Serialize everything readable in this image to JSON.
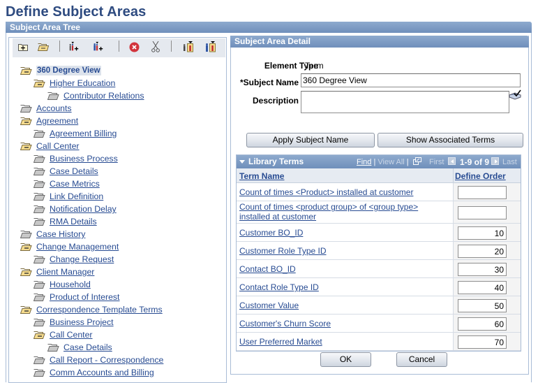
{
  "page": {
    "title": "Define Subject Areas"
  },
  "tree_panel": {
    "header": "Subject Area Tree",
    "toolbar": [
      {
        "name": "insert-sibling-folder-icon",
        "title": "Add Subject"
      },
      {
        "name": "insert-child-folder-icon",
        "title": "Add Child Subject"
      },
      {
        "name": "insert-sibling-term-icon",
        "title": "Add Term"
      },
      {
        "name": "insert-child-term-icon",
        "title": "Add Child Term"
      },
      {
        "name": "delete-icon",
        "title": "Delete"
      },
      {
        "name": "cut-icon",
        "title": "Cut"
      },
      {
        "name": "paste-sibling-icon",
        "title": "Paste as Sibling"
      },
      {
        "name": "paste-child-icon",
        "title": "Paste as Child"
      }
    ],
    "nodes": [
      {
        "label": "360 Degree View",
        "level": 0,
        "open": true,
        "selected": true
      },
      {
        "label": "Higher Education",
        "level": 1,
        "open": true
      },
      {
        "label": "Contributor Relations",
        "level": 2,
        "open": false
      },
      {
        "label": "Accounts",
        "level": 0,
        "open": false
      },
      {
        "label": "Agreement",
        "level": 0,
        "open": true
      },
      {
        "label": "Agreement Billing",
        "level": 1,
        "open": false
      },
      {
        "label": "Call Center",
        "level": 0,
        "open": true
      },
      {
        "label": "Business Process",
        "level": 1,
        "open": false
      },
      {
        "label": "Case Details",
        "level": 1,
        "open": false
      },
      {
        "label": "Case Metrics",
        "level": 1,
        "open": false
      },
      {
        "label": "Link Definition",
        "level": 1,
        "open": false
      },
      {
        "label": "Notification Delay",
        "level": 1,
        "open": false
      },
      {
        "label": "RMA Details",
        "level": 1,
        "open": false
      },
      {
        "label": "Case History",
        "level": 0,
        "open": false
      },
      {
        "label": "Change Management",
        "level": 0,
        "open": true
      },
      {
        "label": "Change Request",
        "level": 1,
        "open": false
      },
      {
        "label": "Client Manager",
        "level": 0,
        "open": true
      },
      {
        "label": "Household",
        "level": 1,
        "open": false
      },
      {
        "label": "Product of Interest",
        "level": 1,
        "open": false
      },
      {
        "label": "Correspondence Template Terms",
        "level": 0,
        "open": true
      },
      {
        "label": "Business Project",
        "level": 1,
        "open": false
      },
      {
        "label": "Call Center",
        "level": 1,
        "open": true
      },
      {
        "label": "Case Details",
        "level": 2,
        "open": false
      },
      {
        "label": "Call Report - Correspondence",
        "level": 1,
        "open": false
      },
      {
        "label": "Comm Accounts and Billing",
        "level": 1,
        "open": false
      }
    ]
  },
  "detail": {
    "header": "Subject Area Detail",
    "element_type_label": "Element Type",
    "element_type_value": "Term",
    "subject_name_label": "*Subject Name",
    "subject_name_value": "360 Degree View",
    "description_label": "Description",
    "description_value": "",
    "apply_button": "Apply Subject Name",
    "show_terms_button": "Show Associated Terms",
    "ok_button": "OK",
    "cancel_button": "Cancel"
  },
  "library_terms": {
    "title": "Library Terms",
    "find": "Find",
    "sep1": "|",
    "view_all": "View All",
    "sep2": "|",
    "first": "First",
    "range": "1-9 of 9",
    "last": "Last",
    "columns": [
      "Term Name",
      "Define Order"
    ],
    "rows": [
      {
        "term": "Count of times <Product> installed at customer",
        "order": ""
      },
      {
        "term": "Count of times <product group> of <group type> installed at customer",
        "order": ""
      },
      {
        "term": "Customer BO_ID",
        "order": "10"
      },
      {
        "term": "Customer Role Type ID",
        "order": "20"
      },
      {
        "term": "Contact BO_ID",
        "order": "30"
      },
      {
        "term": "Contact Role Type ID",
        "order": "40"
      },
      {
        "term": "Customer Value",
        "order": "50"
      },
      {
        "term": "Customer's Churn Score",
        "order": "60"
      },
      {
        "term": "User Preferred Market",
        "order": "70"
      }
    ]
  },
  "colors": {
    "header_blue": "#7C9AC4",
    "title_blue": "#2E4B80",
    "link_blue": "#274B92",
    "folder_open_yellow": "#F6DC8E",
    "folder_closed_grey": "#C8C8C8"
  }
}
